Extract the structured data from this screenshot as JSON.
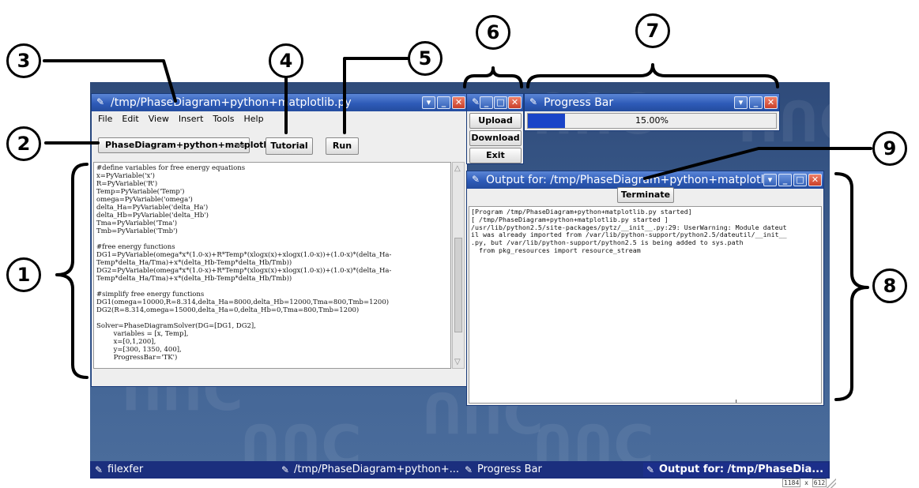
{
  "main_window": {
    "title": "/tmp/PhaseDiagram+python+matplotlib.py",
    "menu": [
      "File",
      "Edit",
      "View",
      "Insert",
      "Tools",
      "Help"
    ],
    "selector_value": "PhaseDiagram+python+matplotlib",
    "tutorial_label": "Tutorial",
    "run_label": "Run",
    "code": "#define variables for free energy equations\nx=PyVariable('x')\nR=PyVariable('R')\nTemp=PyVariable('Temp')\nomega=PyVariable('omega')\ndelta_Ha=PyVariable('delta_Ha')\ndelta_Hb=PyVariable('delta_Hb')\nTma=PyVariable('Tma')\nTmb=PyVariable('Tmb')\n\n#free energy functions\nDG1=PyVariable(omega*x*(1.0-x)+R*Temp*(xlogx(x)+xlogx(1.0-x))+(1.0-x)*(delta_Ha-\nTemp*delta_Ha/Tma)+x*(delta_Hb-Temp*delta_Hb/Tmb))\nDG2=PyVariable(omega*x*(1.0-x)+R*Temp*(xlogx(x)+xlogx(1.0-x))+(1.0-x)*(delta_Ha-\nTemp*delta_Ha/Tma)+x*(delta_Hb-Temp*delta_Hb/Tmb))\n\n#simplify free energy functions\nDG1(omega=10000,R=8.314,delta_Ha=8000,delta_Hb=12000,Tma=800,Tmb=1200)\nDG2(R=8.314,omega=15000,delta_Ha=0,delta_Hb=0,Tma=800,Tmb=1200)\n\nSolver=PhaseDiagramSolver(DG=[DG1, DG2],\n        variables = [x, Temp],\n        x=[0,1,200],\n        y=[300, 1350, 400],\n        ProgressBar='TK')"
  },
  "file_window": {
    "upload_label": "Upload",
    "download_label": "Download",
    "exit_label": "Exit"
  },
  "progress_window": {
    "title": "Progress Bar",
    "progress_text": "15.00%",
    "progress_value": 0.15
  },
  "output_window": {
    "title": "Output for: /tmp/PhaseDiagram+python+matplotli...",
    "terminate_label": "Terminate",
    "text": "[Program /tmp/PhaseDiagram+python+matplotlib.py started]\n[ /tmp/PhaseDiagram+python+matplotlib.py started ]\n/usr/lib/python2.5/site-packages/pytz/__init__.py:29: UserWarning: Module dateut\nil was already imported from /var/lib/python-support/python2.5/dateutil/__init__\n.py, but /var/lib/python-support/python2.5 is being added to sys.path\n  from pkg_resources import resource_stream"
  },
  "taskbar": {
    "items": [
      "filexfer",
      "/tmp/PhaseDiagram+python+...",
      "Progress Bar",
      "Output for: /tmp/PhaseDia..."
    ]
  },
  "size_indicator": {
    "width": "1184",
    "sep": "x",
    "height": "612"
  },
  "callouts": [
    "1",
    "2",
    "3",
    "4",
    "5",
    "6",
    "7",
    "8",
    "9"
  ],
  "colors": {
    "titlebar": "#2e5bb8",
    "progress_fill": "#1a44c8",
    "taskbar": "#1b2f7e"
  }
}
